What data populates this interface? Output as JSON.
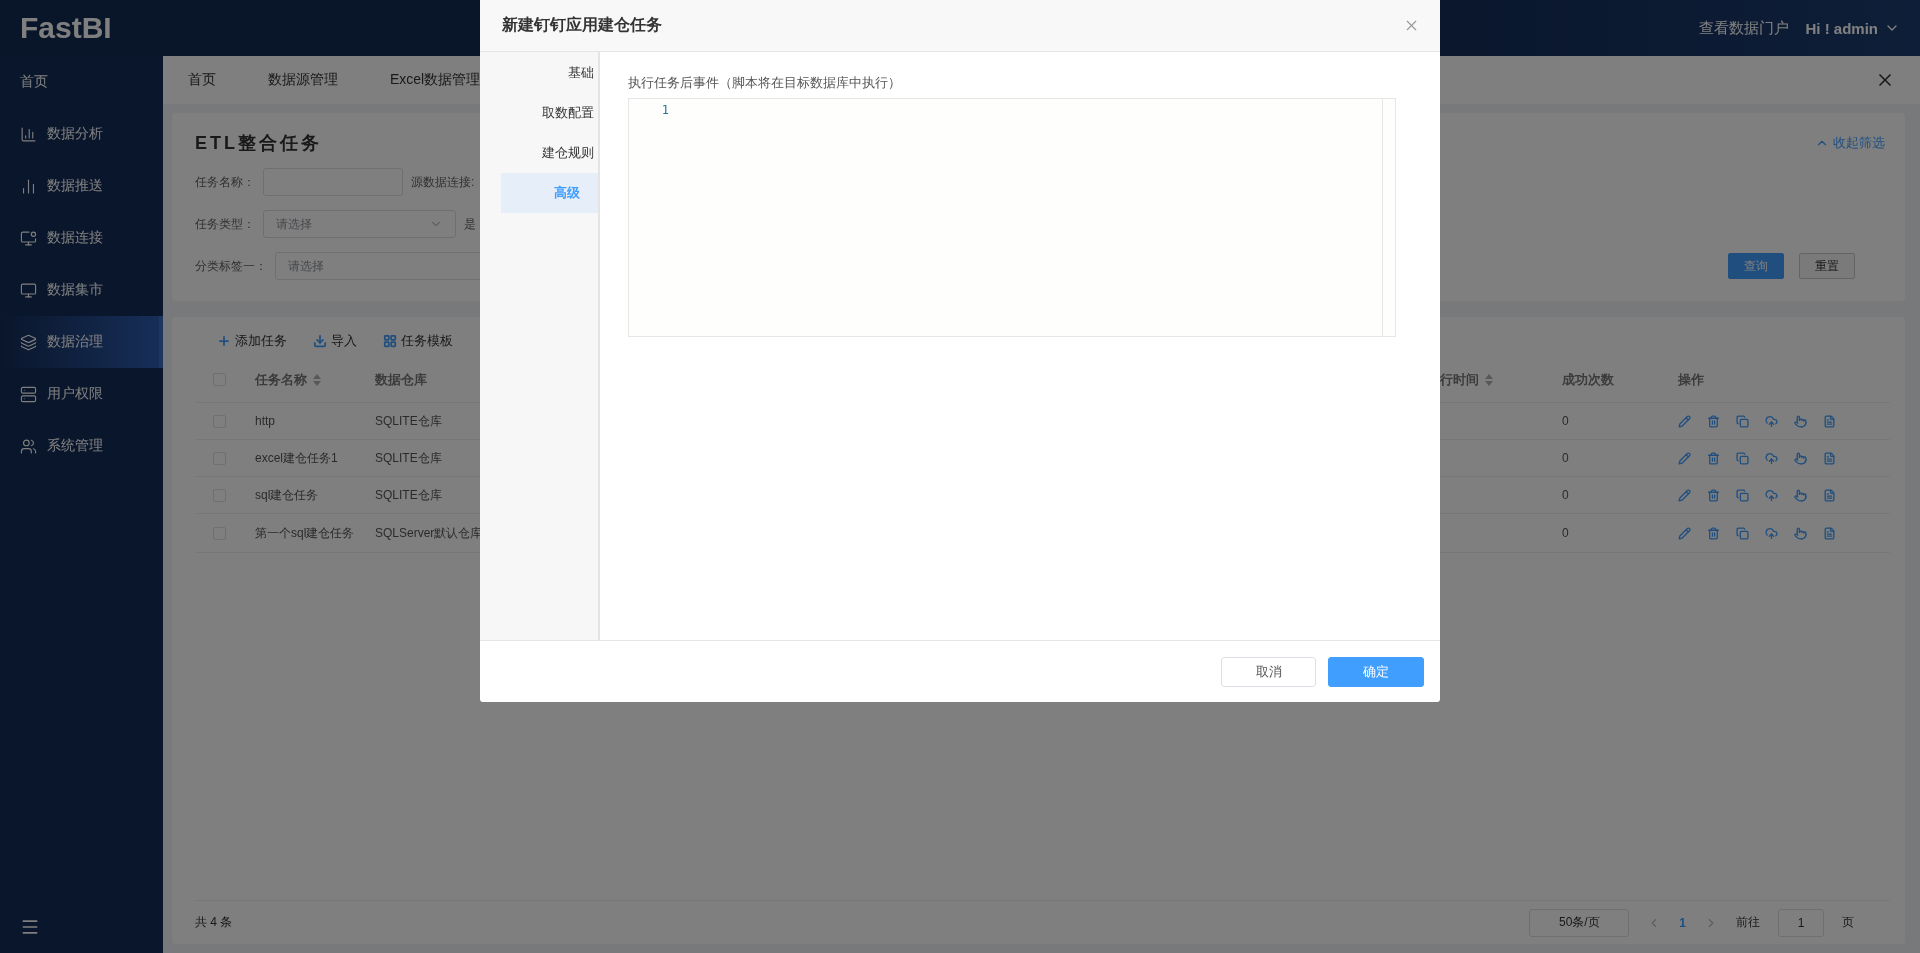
{
  "header": {
    "logo": "FastBI",
    "portal_link": "查看数据门户",
    "user": "Hi ! admin"
  },
  "sidebar": {
    "items": [
      {
        "label": "首页",
        "selected": false
      },
      {
        "label": "数据分析",
        "selected": false
      },
      {
        "label": "数据推送",
        "selected": false
      },
      {
        "label": "数据连接",
        "selected": false
      },
      {
        "label": "数据集市",
        "selected": false
      },
      {
        "label": "数据治理",
        "selected": true
      },
      {
        "label": "用户权限",
        "selected": false
      },
      {
        "label": "系统管理",
        "selected": false
      }
    ]
  },
  "page_tabs": [
    {
      "label": "首页"
    },
    {
      "label": "数据源管理"
    },
    {
      "label": "Excel数据管理"
    }
  ],
  "filter": {
    "title": "ETL整合任务",
    "collapse_link": "收起筛选",
    "rows": [
      [
        {
          "kind": "input",
          "label": "任务名称："
        },
        {
          "kind": "label",
          "label": "源数据连接:"
        }
      ],
      [
        {
          "kind": "select",
          "label": "任务类型：",
          "placeholder": "请选择"
        },
        {
          "kind": "label",
          "label": "是"
        }
      ],
      [
        {
          "kind": "wide",
          "label": "分类标签一：",
          "placeholder": "请选择"
        }
      ]
    ],
    "buttons": [
      {
        "label": "查询",
        "kind": "primary"
      },
      {
        "label": "重置",
        "kind": "default"
      }
    ]
  },
  "toolbar": [
    {
      "label": "添加任务",
      "kind": "add"
    },
    {
      "label": "导入",
      "kind": "import"
    },
    {
      "label": "任务模板",
      "kind": "template"
    }
  ],
  "table": {
    "select_all": {
      "checked": false
    },
    "columns": [
      {
        "label": "任务名称",
        "sortable": true
      },
      {
        "label": "数据仓库",
        "sortable": false
      },
      {
        "label": "行时间",
        "sortable": true
      },
      {
        "label": "成功次数",
        "sortable": false
      },
      {
        "label": "操作",
        "sortable": false
      }
    ],
    "rows": [
      {
        "checked": false,
        "name": "http",
        "warehouse": "SQLITE仓库",
        "success_count": "0"
      },
      {
        "checked": false,
        "name": "excel建仓任务1",
        "warehouse": "SQLITE仓库",
        "success_count": "0"
      },
      {
        "checked": false,
        "name": "sql建仓任务",
        "warehouse": "SQLITE仓库",
        "success_count": "0"
      },
      {
        "checked": false,
        "name": "第一个sql建仓任务",
        "warehouse": "SQLServer默认仓库",
        "success_count": "0"
      }
    ]
  },
  "pagination": {
    "total": "共 4 条",
    "page_size": "50条/页",
    "pages": [
      {
        "label": "1",
        "selected": true
      }
    ],
    "goto_label": "前往",
    "goto_value": "1",
    "page_suffix": "页"
  },
  "modal": {
    "title": "新建钉钉应用建仓任务",
    "nav": [
      {
        "label": "基础",
        "selected": false
      },
      {
        "label": "取数配置",
        "selected": false
      },
      {
        "label": "建仓规则",
        "selected": false
      },
      {
        "label": "高级",
        "selected": true
      }
    ],
    "field_label": "执行任务后事件（脚本将在目标数据库中执行）",
    "editor": {
      "line_numbers": [
        "1"
      ]
    },
    "buttons": [
      {
        "label": "取消",
        "kind": "default"
      },
      {
        "label": "确定",
        "kind": "primary"
      }
    ]
  }
}
